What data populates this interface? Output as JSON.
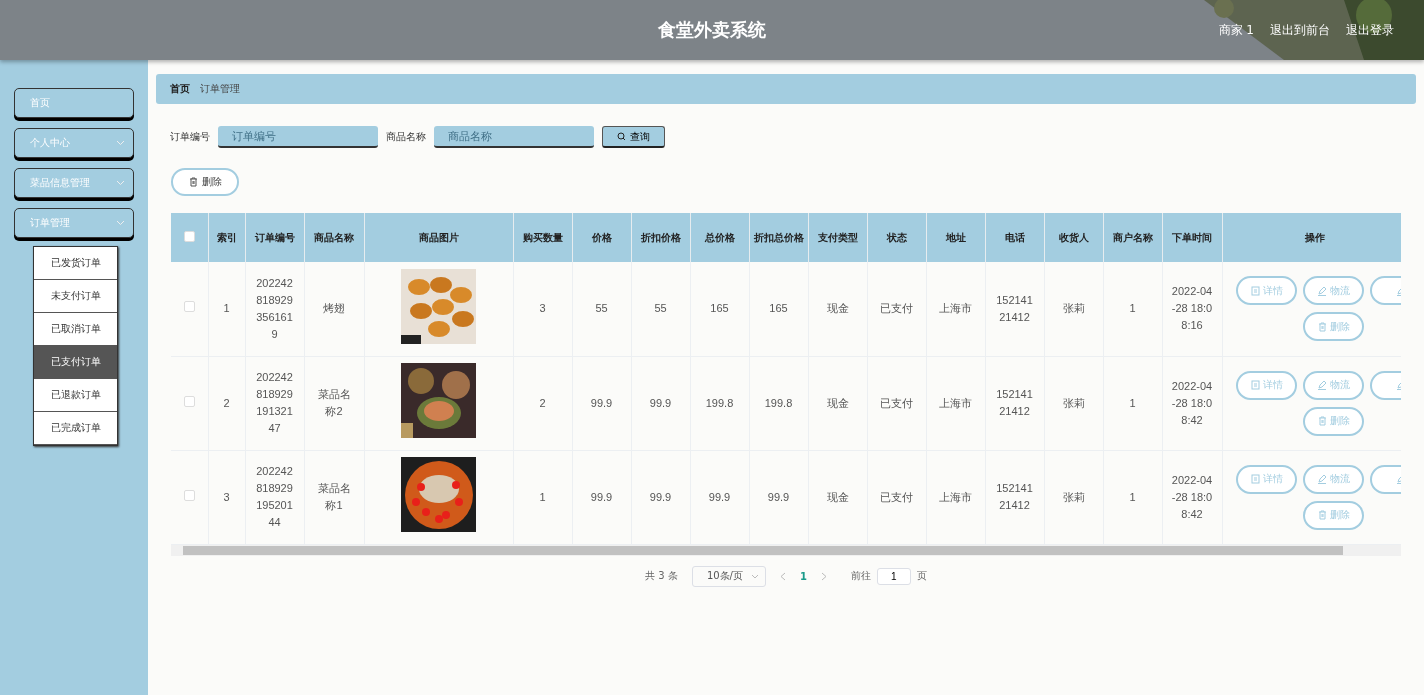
{
  "header": {
    "title": "食堂外卖系统",
    "links": [
      "商家 1",
      "退出到前台",
      "退出登录"
    ]
  },
  "sidebar": {
    "items": [
      {
        "label": "首页",
        "expandable": false
      },
      {
        "label": "个人中心",
        "expandable": true
      },
      {
        "label": "菜品信息管理",
        "expandable": true
      },
      {
        "label": "订单管理",
        "expandable": true,
        "expanded": true,
        "children": [
          {
            "label": "已发货订单",
            "selected": false
          },
          {
            "label": "未支付订单",
            "selected": false
          },
          {
            "label": "已取消订单",
            "selected": false
          },
          {
            "label": "已支付订单",
            "selected": true
          },
          {
            "label": "已退款订单",
            "selected": false
          },
          {
            "label": "已完成订单",
            "selected": false
          }
        ]
      }
    ]
  },
  "breadcrumb": [
    "首页",
    "订单管理"
  ],
  "search": {
    "fields": [
      {
        "label": "订单编号",
        "placeholder": "订单编号"
      },
      {
        "label": "商品名称",
        "placeholder": "商品名称"
      }
    ],
    "button": "查询"
  },
  "delete_button": "删除",
  "table": {
    "all_checked": false,
    "columns": [
      "索引",
      "订单编号",
      "商品名称",
      "商品图片",
      "购买数量",
      "价格",
      "折扣价格",
      "总价格",
      "折扣总价格",
      "支付类型",
      "状态",
      "地址",
      "电话",
      "收货人",
      "商户名称",
      "下单时间",
      "操作"
    ],
    "rows": [
      {
        "checked": false,
        "cells": [
          "1",
          "2022428189293561619",
          "烤翅",
          "",
          "3",
          "55",
          "55",
          "165",
          "165",
          "现金",
          "已支付",
          "上海市",
          "15214121412",
          "张莉",
          "1",
          "2022-04-28 18:08:16"
        ],
        "picture": {
          "kind": "picture"
        },
        "actions": [
          {
            "kind": "detail",
            "label": "详情"
          },
          {
            "kind": "edit",
            "label": "物流"
          },
          {
            "kind": "edit"
          },
          {
            "kind": "delete",
            "label": "删除"
          }
        ]
      },
      {
        "checked": false,
        "cells": [
          "2",
          "20224281892919132147",
          "菜品名称2",
          "",
          "2",
          "99.9",
          "99.9",
          "199.8",
          "199.8",
          "现金",
          "已支付",
          "上海市",
          "15214121412",
          "张莉",
          "1",
          "2022-04-28 18:08:42"
        ],
        "picture": {
          "kind": "picture"
        },
        "actions": [
          {
            "kind": "detail",
            "label": "详情"
          },
          {
            "kind": "edit",
            "label": "物流"
          },
          {
            "kind": "edit"
          },
          {
            "kind": "delete",
            "label": "删除"
          }
        ]
      },
      {
        "checked": false,
        "cells": [
          "3",
          "20224281892919520144",
          "菜品名称1",
          "",
          "1",
          "99.9",
          "99.9",
          "99.9",
          "99.9",
          "现金",
          "已支付",
          "上海市",
          "15214121412",
          "张莉",
          "1",
          "2022-04-28 18:08:42"
        ],
        "picture": {
          "kind": "picture"
        },
        "actions": [
          {
            "kind": "detail",
            "label": "详情"
          },
          {
            "kind": "edit",
            "label": "物流"
          },
          {
            "kind": "edit"
          },
          {
            "kind": "delete",
            "label": "删除"
          }
        ]
      }
    ]
  },
  "pagination": {
    "total": "共 3 条",
    "page_size": "10条/页",
    "pages": [
      {
        "label": "1",
        "selected": true
      }
    ],
    "goto_label": "前往",
    "goto_value": "1",
    "page_suffix": "页"
  }
}
